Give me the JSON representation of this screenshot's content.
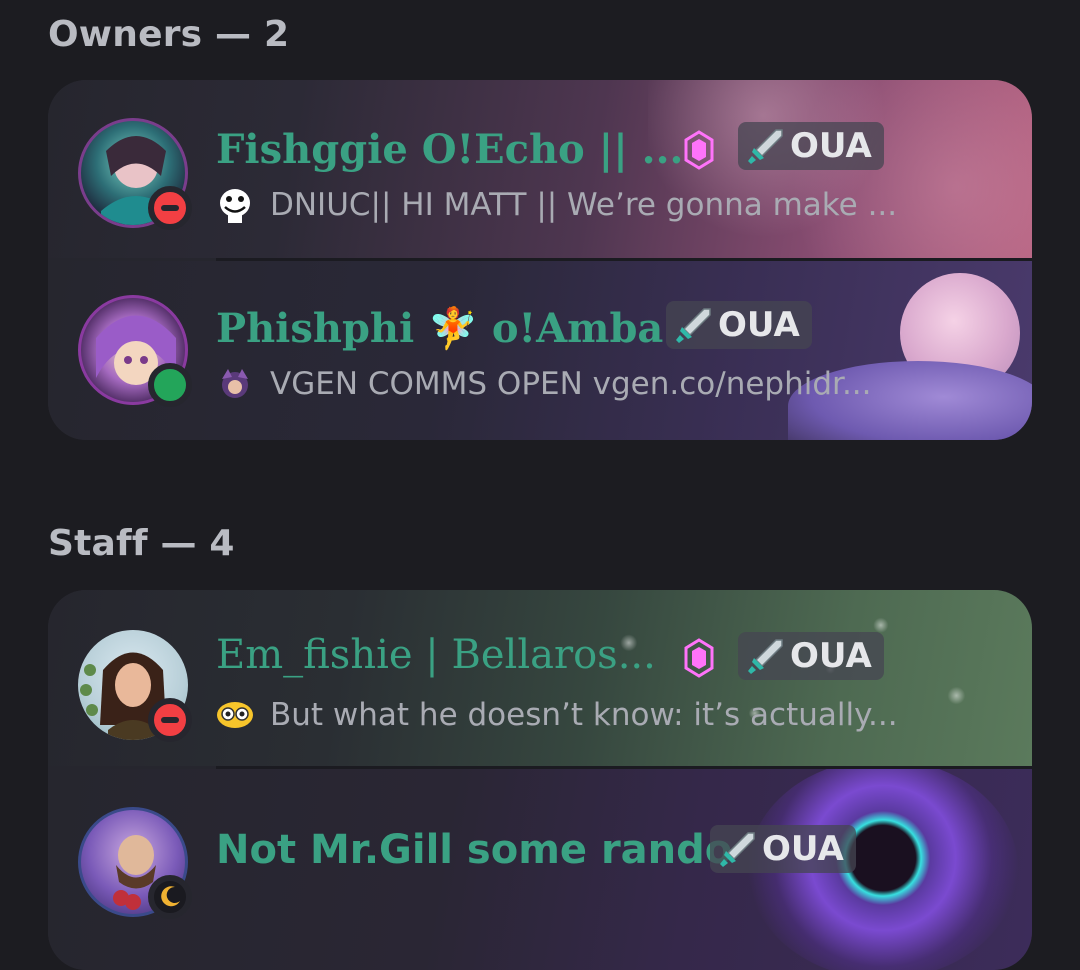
{
  "sections": [
    {
      "header": "Owners — 2",
      "members": [
        {
          "name": "Fishggie O!Echo || ...",
          "status": "dnd",
          "activity": "DNIUC|| HI MATT || We’re gonna make ...",
          "tag": "OUA",
          "boost": true,
          "name_color": "#3aa183"
        },
        {
          "name": "Phishphi 🧚 o!Amba",
          "status": "online",
          "activity": "VGEN COMMS OPEN vgen.co/nephidr...",
          "tag": "OUA",
          "boost": false,
          "name_color": "#3aa183"
        }
      ]
    },
    {
      "header": "Staff — 4",
      "members": [
        {
          "name": "Em_fishie | Bellaros...",
          "status": "dnd",
          "activity": "But what he doesn’t know: it’s actually...",
          "tag": "OUA",
          "boost": true,
          "name_color": "#3aa183"
        },
        {
          "name": "Not Mr.Gill some rando",
          "status": "idle",
          "activity": "",
          "tag": "OUA",
          "boost": false,
          "name_color": "#3aa183"
        }
      ]
    }
  ],
  "colors": {
    "background": "#1c1c21",
    "card": "#26262e",
    "dnd": "#f23f43",
    "online": "#23a55a",
    "idle": "#f0b232",
    "boost": "#ff73fa"
  }
}
